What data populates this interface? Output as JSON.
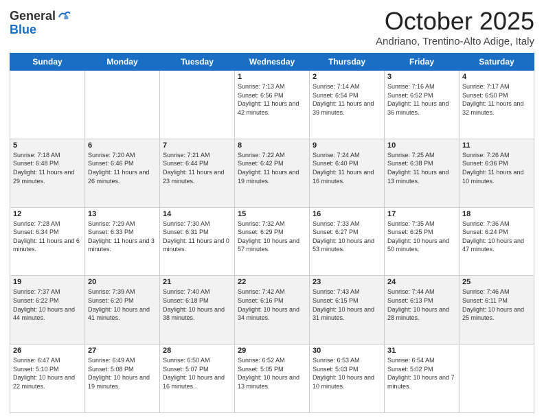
{
  "header": {
    "logo_general": "General",
    "logo_blue": "Blue",
    "month": "October 2025",
    "location": "Andriano, Trentino-Alto Adige, Italy"
  },
  "days_of_week": [
    "Sunday",
    "Monday",
    "Tuesday",
    "Wednesday",
    "Thursday",
    "Friday",
    "Saturday"
  ],
  "weeks": [
    [
      {
        "day": "",
        "sunrise": "",
        "sunset": "",
        "daylight": ""
      },
      {
        "day": "",
        "sunrise": "",
        "sunset": "",
        "daylight": ""
      },
      {
        "day": "",
        "sunrise": "",
        "sunset": "",
        "daylight": ""
      },
      {
        "day": "1",
        "sunrise": "Sunrise: 7:13 AM",
        "sunset": "Sunset: 6:56 PM",
        "daylight": "Daylight: 11 hours and 42 minutes."
      },
      {
        "day": "2",
        "sunrise": "Sunrise: 7:14 AM",
        "sunset": "Sunset: 6:54 PM",
        "daylight": "Daylight: 11 hours and 39 minutes."
      },
      {
        "day": "3",
        "sunrise": "Sunrise: 7:16 AM",
        "sunset": "Sunset: 6:52 PM",
        "daylight": "Daylight: 11 hours and 36 minutes."
      },
      {
        "day": "4",
        "sunrise": "Sunrise: 7:17 AM",
        "sunset": "Sunset: 6:50 PM",
        "daylight": "Daylight: 11 hours and 32 minutes."
      }
    ],
    [
      {
        "day": "5",
        "sunrise": "Sunrise: 7:18 AM",
        "sunset": "Sunset: 6:48 PM",
        "daylight": "Daylight: 11 hours and 29 minutes."
      },
      {
        "day": "6",
        "sunrise": "Sunrise: 7:20 AM",
        "sunset": "Sunset: 6:46 PM",
        "daylight": "Daylight: 11 hours and 26 minutes."
      },
      {
        "day": "7",
        "sunrise": "Sunrise: 7:21 AM",
        "sunset": "Sunset: 6:44 PM",
        "daylight": "Daylight: 11 hours and 23 minutes."
      },
      {
        "day": "8",
        "sunrise": "Sunrise: 7:22 AM",
        "sunset": "Sunset: 6:42 PM",
        "daylight": "Daylight: 11 hours and 19 minutes."
      },
      {
        "day": "9",
        "sunrise": "Sunrise: 7:24 AM",
        "sunset": "Sunset: 6:40 PM",
        "daylight": "Daylight: 11 hours and 16 minutes."
      },
      {
        "day": "10",
        "sunrise": "Sunrise: 7:25 AM",
        "sunset": "Sunset: 6:38 PM",
        "daylight": "Daylight: 11 hours and 13 minutes."
      },
      {
        "day": "11",
        "sunrise": "Sunrise: 7:26 AM",
        "sunset": "Sunset: 6:36 PM",
        "daylight": "Daylight: 11 hours and 10 minutes."
      }
    ],
    [
      {
        "day": "12",
        "sunrise": "Sunrise: 7:28 AM",
        "sunset": "Sunset: 6:34 PM",
        "daylight": "Daylight: 11 hours and 6 minutes."
      },
      {
        "day": "13",
        "sunrise": "Sunrise: 7:29 AM",
        "sunset": "Sunset: 6:33 PM",
        "daylight": "Daylight: 11 hours and 3 minutes."
      },
      {
        "day": "14",
        "sunrise": "Sunrise: 7:30 AM",
        "sunset": "Sunset: 6:31 PM",
        "daylight": "Daylight: 11 hours and 0 minutes."
      },
      {
        "day": "15",
        "sunrise": "Sunrise: 7:32 AM",
        "sunset": "Sunset: 6:29 PM",
        "daylight": "Daylight: 10 hours and 57 minutes."
      },
      {
        "day": "16",
        "sunrise": "Sunrise: 7:33 AM",
        "sunset": "Sunset: 6:27 PM",
        "daylight": "Daylight: 10 hours and 53 minutes."
      },
      {
        "day": "17",
        "sunrise": "Sunrise: 7:35 AM",
        "sunset": "Sunset: 6:25 PM",
        "daylight": "Daylight: 10 hours and 50 minutes."
      },
      {
        "day": "18",
        "sunrise": "Sunrise: 7:36 AM",
        "sunset": "Sunset: 6:24 PM",
        "daylight": "Daylight: 10 hours and 47 minutes."
      }
    ],
    [
      {
        "day": "19",
        "sunrise": "Sunrise: 7:37 AM",
        "sunset": "Sunset: 6:22 PM",
        "daylight": "Daylight: 10 hours and 44 minutes."
      },
      {
        "day": "20",
        "sunrise": "Sunrise: 7:39 AM",
        "sunset": "Sunset: 6:20 PM",
        "daylight": "Daylight: 10 hours and 41 minutes."
      },
      {
        "day": "21",
        "sunrise": "Sunrise: 7:40 AM",
        "sunset": "Sunset: 6:18 PM",
        "daylight": "Daylight: 10 hours and 38 minutes."
      },
      {
        "day": "22",
        "sunrise": "Sunrise: 7:42 AM",
        "sunset": "Sunset: 6:16 PM",
        "daylight": "Daylight: 10 hours and 34 minutes."
      },
      {
        "day": "23",
        "sunrise": "Sunrise: 7:43 AM",
        "sunset": "Sunset: 6:15 PM",
        "daylight": "Daylight: 10 hours and 31 minutes."
      },
      {
        "day": "24",
        "sunrise": "Sunrise: 7:44 AM",
        "sunset": "Sunset: 6:13 PM",
        "daylight": "Daylight: 10 hours and 28 minutes."
      },
      {
        "day": "25",
        "sunrise": "Sunrise: 7:46 AM",
        "sunset": "Sunset: 6:11 PM",
        "daylight": "Daylight: 10 hours and 25 minutes."
      }
    ],
    [
      {
        "day": "26",
        "sunrise": "Sunrise: 6:47 AM",
        "sunset": "Sunset: 5:10 PM",
        "daylight": "Daylight: 10 hours and 22 minutes."
      },
      {
        "day": "27",
        "sunrise": "Sunrise: 6:49 AM",
        "sunset": "Sunset: 5:08 PM",
        "daylight": "Daylight: 10 hours and 19 minutes."
      },
      {
        "day": "28",
        "sunrise": "Sunrise: 6:50 AM",
        "sunset": "Sunset: 5:07 PM",
        "daylight": "Daylight: 10 hours and 16 minutes."
      },
      {
        "day": "29",
        "sunrise": "Sunrise: 6:52 AM",
        "sunset": "Sunset: 5:05 PM",
        "daylight": "Daylight: 10 hours and 13 minutes."
      },
      {
        "day": "30",
        "sunrise": "Sunrise: 6:53 AM",
        "sunset": "Sunset: 5:03 PM",
        "daylight": "Daylight: 10 hours and 10 minutes."
      },
      {
        "day": "31",
        "sunrise": "Sunrise: 6:54 AM",
        "sunset": "Sunset: 5:02 PM",
        "daylight": "Daylight: 10 hours and 7 minutes."
      },
      {
        "day": "",
        "sunrise": "",
        "sunset": "",
        "daylight": ""
      }
    ]
  ]
}
